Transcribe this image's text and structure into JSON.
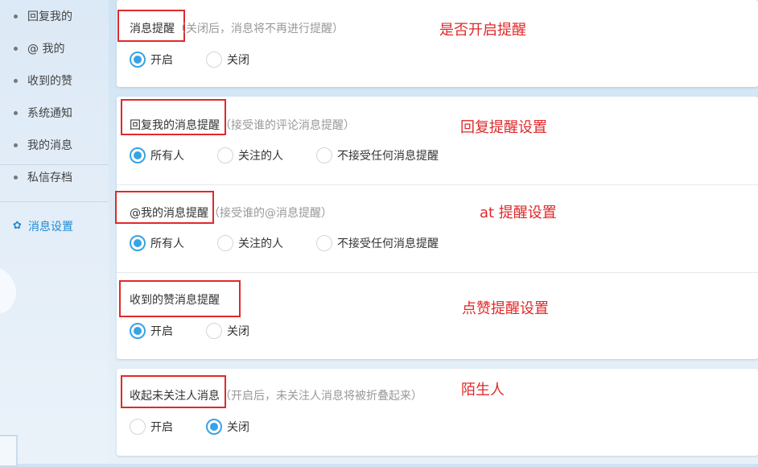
{
  "sidebar": {
    "items": [
      {
        "label": "回复我的"
      },
      {
        "label": "@ 我的"
      },
      {
        "label": "收到的赞"
      },
      {
        "label": "系统通知"
      },
      {
        "label": "我的消息"
      },
      {
        "label": "私信存档"
      }
    ],
    "settings_label": "消息设置"
  },
  "sections": {
    "enable": {
      "title": "消息提醒",
      "hint": "（关闭后，消息将不再进行提醒）",
      "note": "是否开启提醒",
      "options": [
        "开启",
        "关闭"
      ],
      "selected": "开启"
    },
    "reply": {
      "title": "回复我的消息提醒",
      "hint": "（接受谁的评论消息提醒）",
      "note": "回复提醒设置",
      "options": [
        "所有人",
        "关注的人",
        "不接受任何消息提醒"
      ],
      "selected": "所有人"
    },
    "at": {
      "title": "@我的消息提醒",
      "hint": "（接受谁的@消息提醒）",
      "note": "at 提醒设置",
      "options": [
        "所有人",
        "关注的人",
        "不接受任何消息提醒"
      ],
      "selected": "所有人"
    },
    "like": {
      "title": "收到的赞消息提醒",
      "hint": "",
      "note": "点赞提醒设置",
      "options": [
        "开启",
        "关闭"
      ],
      "selected": "开启"
    },
    "stranger": {
      "title": "收起未关注人消息",
      "hint": "（开启后，未关注人消息将被折叠起来）",
      "note": "陌生人",
      "options": [
        "开启",
        "关闭"
      ],
      "selected": "关闭"
    }
  },
  "colors": {
    "accent": "#37a3e6",
    "annotation": "#e0292a",
    "sidebar_active": "#1f8ad4"
  }
}
